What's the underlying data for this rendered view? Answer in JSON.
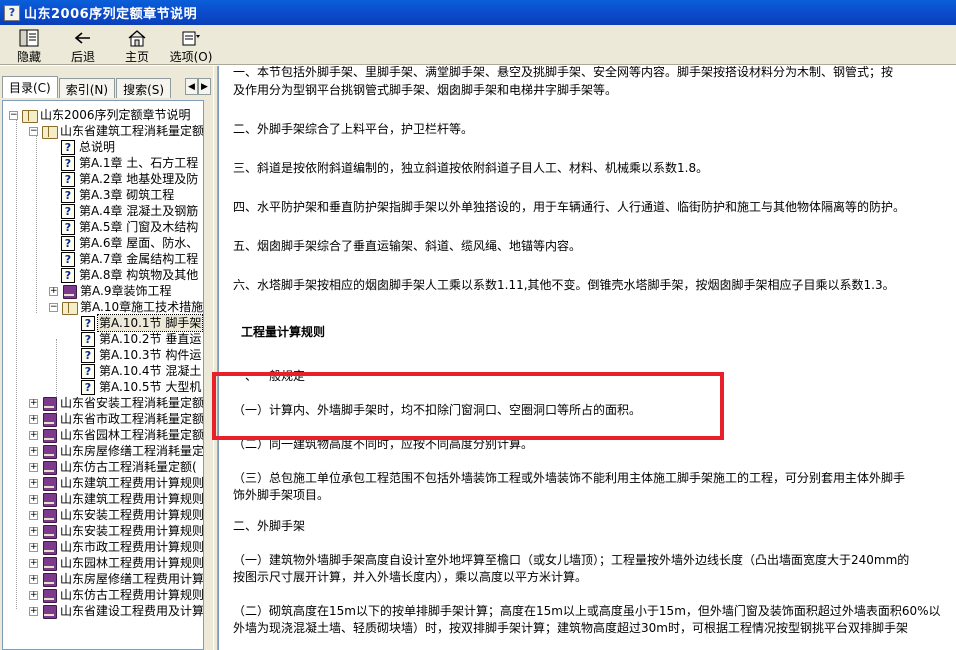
{
  "window": {
    "title": "山东2006序列定额章节说明",
    "icon_glyph": "?"
  },
  "toolbar": {
    "buttons": [
      {
        "label": "隐藏",
        "icon": "hide-icon"
      },
      {
        "label": "后退",
        "icon": "back-arrow-icon"
      },
      {
        "label": "主页",
        "icon": "home-icon"
      },
      {
        "label": "选项(O)",
        "icon": "options-icon"
      }
    ]
  },
  "tabs": [
    {
      "label": "目录(C)",
      "active": true
    },
    {
      "label": "索引(N)",
      "active": false
    },
    {
      "label": "搜索(S)",
      "active": false
    }
  ],
  "tree": {
    "root": "山东2006序列定额章节说明",
    "items": [
      "山东省建筑工程消耗量定额",
      "总说明",
      "第A.1章 土、石方工程",
      "第A.2章 地基处理及防",
      "第A.3章 砌筑工程",
      "第A.4章 混凝土及钢筋",
      "第A.5章 门窗及木结构",
      "第A.6章 屋面、防水、",
      "第A.7章 金属结构工程",
      "第A.8章 构筑物及其他",
      "第A.9章装饰工程",
      "第A.10章施工技术措施",
      "第A.10.1节 脚手架",
      "第A.10.2节 垂直运",
      "第A.10.3节 构件运",
      "第A.10.4节 混凝土",
      "第A.10.5节 大型机",
      "山东省安装工程消耗量定额",
      "山东省市政工程消耗量定额",
      "山东省园林工程消耗量定额",
      "山东房屋修缮工程消耗量定额",
      "山东仿古工程消耗量定额(",
      "山东建筑工程费用计算规则",
      "山东建筑工程费用计算规则",
      "山东安装工程费用计算规则",
      "山东安装工程费用计算规则",
      "山东市政工程费用计算规则",
      "山东园林工程费用计算规则",
      "山东房屋修缮工程费用计算",
      "山东仿古工程费用计算规则",
      "山东省建设工程费用及计算"
    ]
  },
  "content": {
    "paragraphs": [
      "一、本节包括外脚手架、里脚手架、满堂脚手架、悬空及挑脚手架、安全网等内容。脚手架按搭设材料分为木制、钢管式；按",
      "及作用分为型钢平台挑钢管式脚手架、烟囱脚手架和电梯井字脚手架等。",
      "二、外脚手架综合了上料平台，护卫栏杆等。",
      "三、斜道是按依附斜道编制的，独立斜道按依附斜道子目人工、材料、机械乘以系数1.8。",
      "四、水平防护架和垂直防护架指脚手架以外单独搭设的，用于车辆通行、人行通道、临街防护和施工与其他物体隔离等的防护。",
      "五、烟囱脚手架综合了垂直运输架、斜道、缆风绳、地锚等内容。",
      "六、水塔脚手架按相应的烟囱脚手架人工乘以系数1.11,其他不变。倒锥壳水塔脚手架，按烟囱脚手架相应子目乘以系数1.3。",
      "工程量计算规则",
      "一、一般规定",
      "（一）计算内、外墙脚手架时，均不扣除门窗洞口、空圈洞口等所占的面积。",
      "（二）同一建筑物高度不同时，应按不同高度分别计算。",
      "（三）总包施工单位承包工程范围不包括外墙装饰工程或外墙装饰不能利用主体施工脚手架施工的工程，可分别套用主体外脚手",
      "饰外脚手架项目。",
      "二、外脚手架",
      "（一）建筑物外墙脚手架高度自设计室外地坪算至檐口（或女儿墙顶）；工程量按外墙外边线长度（凸出墙面宽度大于240mm的",
      "按图示尺寸展开计算，并入外墙长度内），乘以高度以平方米计算。",
      "（二）砌筑高度在15m以下的按单排脚手架计算；高度在15m以上或高度虽小于15m，但外墙门窗及装饰面积超过外墙表面积60%以",
      "外墙为现浇混凝土墙、轻质砌块墙）时，按双排脚手架计算；建筑物高度超过30m时，可根据工程情况按型钢挑平台双排脚手架"
    ]
  },
  "colors": {
    "highlight": "#e8202a",
    "title_bar": "#0b4fcf",
    "panel": "#ece9d8"
  }
}
